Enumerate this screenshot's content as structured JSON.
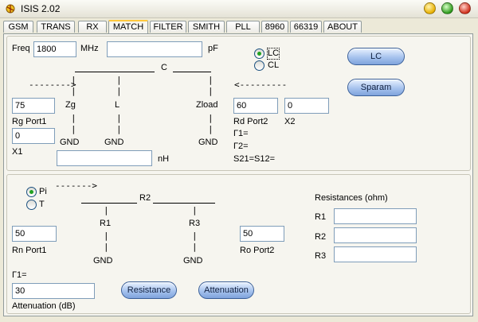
{
  "window": {
    "title": "ISIS 2.02"
  },
  "tabs": [
    "GSM",
    "TRANS",
    "RX",
    "MATCH",
    "FILTER",
    "SMITH",
    "PLL",
    "8960",
    "66319",
    "ABOUT"
  ],
  "active_tab": "MATCH",
  "lc": {
    "freq_label": "Freq",
    "freq_value": "1800",
    "freq_unit": "MHz",
    "pf_value": "",
    "pf_unit": "pF",
    "radio_lc": "LC",
    "radio_cl": "CL",
    "selected": "LC",
    "arrow_left": "-------->",
    "arrow_right": "<---------",
    "c_label": "C",
    "zg": "Zg",
    "l": "L",
    "zload": "Zload",
    "gnd": "GND",
    "rg_value": "75",
    "rg_label": "Rg  Port1",
    "x1_value": "0",
    "x1_label": "X1",
    "nh_value": "",
    "nh_unit": "nH",
    "rd_value": "60",
    "rd_label": "Rd  Port2",
    "x2_value": "0",
    "x2_label": "X2",
    "gamma1": "Γ1=",
    "gamma2": "Γ2=",
    "s21": "S21=S12=",
    "btn_lc": "LC",
    "btn_sparam": "Sparam"
  },
  "atten": {
    "radio_pi": "Pi",
    "radio_t": "T",
    "selected": "Pi",
    "arrow": "------->",
    "r2": "R2",
    "r1": "R1",
    "r3": "R3",
    "gnd": "GND",
    "rn_value": "50",
    "rn_label": "Rn   Port1",
    "ro_value": "50",
    "ro_label": "Ro   Port2",
    "resistances_title": "Resistances (ohm)",
    "res_r1": "R1",
    "res_r2": "R2",
    "res_r3": "R3",
    "res_r1_value": "",
    "res_r2_value": "",
    "res_r3_value": "",
    "gamma1": "Γ1=",
    "atten_value": "30",
    "atten_label": "Attenuation (dB)",
    "btn_resistance": "Resistance",
    "btn_attenuation": "Attenuation"
  }
}
